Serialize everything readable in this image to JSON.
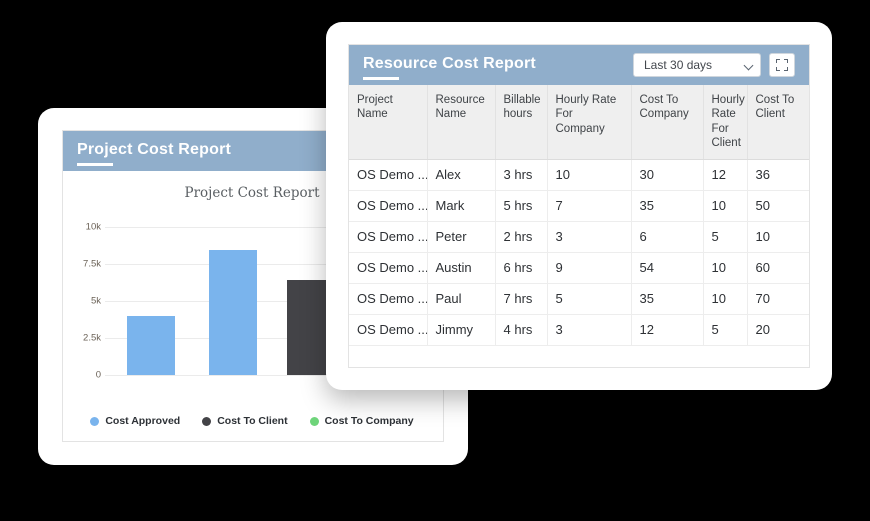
{
  "background": "#000000",
  "chart_card": {
    "header": {
      "title": "Project Cost Report"
    },
    "chart_data": {
      "type": "bar",
      "title": "Project Cost Report",
      "categories": [
        "Cost Approved",
        "Cost To Client",
        "Cost To Company"
      ],
      "values": [
        3700,
        7900,
        6000,
        150
      ],
      "bars": [
        {
          "label": "Cost Approved",
          "value": 3700,
          "color": "#7ab4ed"
        },
        {
          "label": "Cost Approved",
          "value": 7900,
          "color": "#7ab4ed"
        },
        {
          "label": "Cost To Client",
          "value": 6000,
          "color": "#434347"
        },
        {
          "label": "Cost To Company",
          "value": 150,
          "color": "#6ed47a"
        }
      ],
      "yticks": [
        "10k",
        "7.5k",
        "5k",
        "2.5k",
        "0"
      ],
      "ylim": [
        0,
        10000
      ],
      "xlabel": "",
      "ylabel": "",
      "grid": true,
      "legend_position": "bottom",
      "legend": [
        {
          "label": "Cost Approved",
          "color": "#7ab4ed"
        },
        {
          "label": "Cost To Client",
          "color": "#434347"
        },
        {
          "label": "Cost To Company",
          "color": "#6ed47a"
        }
      ]
    }
  },
  "table_card": {
    "header": {
      "title": "Resource Cost Report",
      "range_value": "Last 30 days",
      "fullscreen_icon": "fullscreen-icon",
      "chevron_icon": "chevron-down-icon"
    },
    "columns": [
      "Project Name",
      "Resource Name",
      "Billable hours",
      "Hourly Rate For Company",
      "Cost To Company",
      "Hourly Rate For Client",
      "Cost To Client"
    ],
    "rows": [
      {
        "project": "OS Demo ...",
        "resource": "Alex",
        "billable": "3 hrs",
        "rate_company": "10",
        "cost_company": "30",
        "rate_client": "12",
        "cost_client": "36"
      },
      {
        "project": "OS Demo ...",
        "resource": "Mark",
        "billable": "5 hrs",
        "rate_company": "7",
        "cost_company": "35",
        "rate_client": "10",
        "cost_client": "50"
      },
      {
        "project": "OS Demo ...",
        "resource": "Peter",
        "billable": "2 hrs",
        "rate_company": "3",
        "cost_company": "6",
        "rate_client": "5",
        "cost_client": "10"
      },
      {
        "project": "OS Demo ...",
        "resource": "Austin",
        "billable": "6 hrs",
        "rate_company": "9",
        "cost_company": "54",
        "rate_client": "10",
        "cost_client": "60"
      },
      {
        "project": "OS Demo ...",
        "resource": "Paul",
        "billable": "7 hrs",
        "rate_company": "5",
        "cost_company": "35",
        "rate_client": "10",
        "cost_client": "70"
      },
      {
        "project": "OS Demo ...",
        "resource": "Jimmy",
        "billable": "4 hrs",
        "rate_company": "3",
        "cost_company": "12",
        "rate_client": "5",
        "cost_client": "20"
      }
    ]
  },
  "colors": {
    "header_bar": "#90aecb",
    "bar_blue": "#7ab4ed",
    "bar_dark": "#434347",
    "bar_green": "#6ed47a"
  }
}
